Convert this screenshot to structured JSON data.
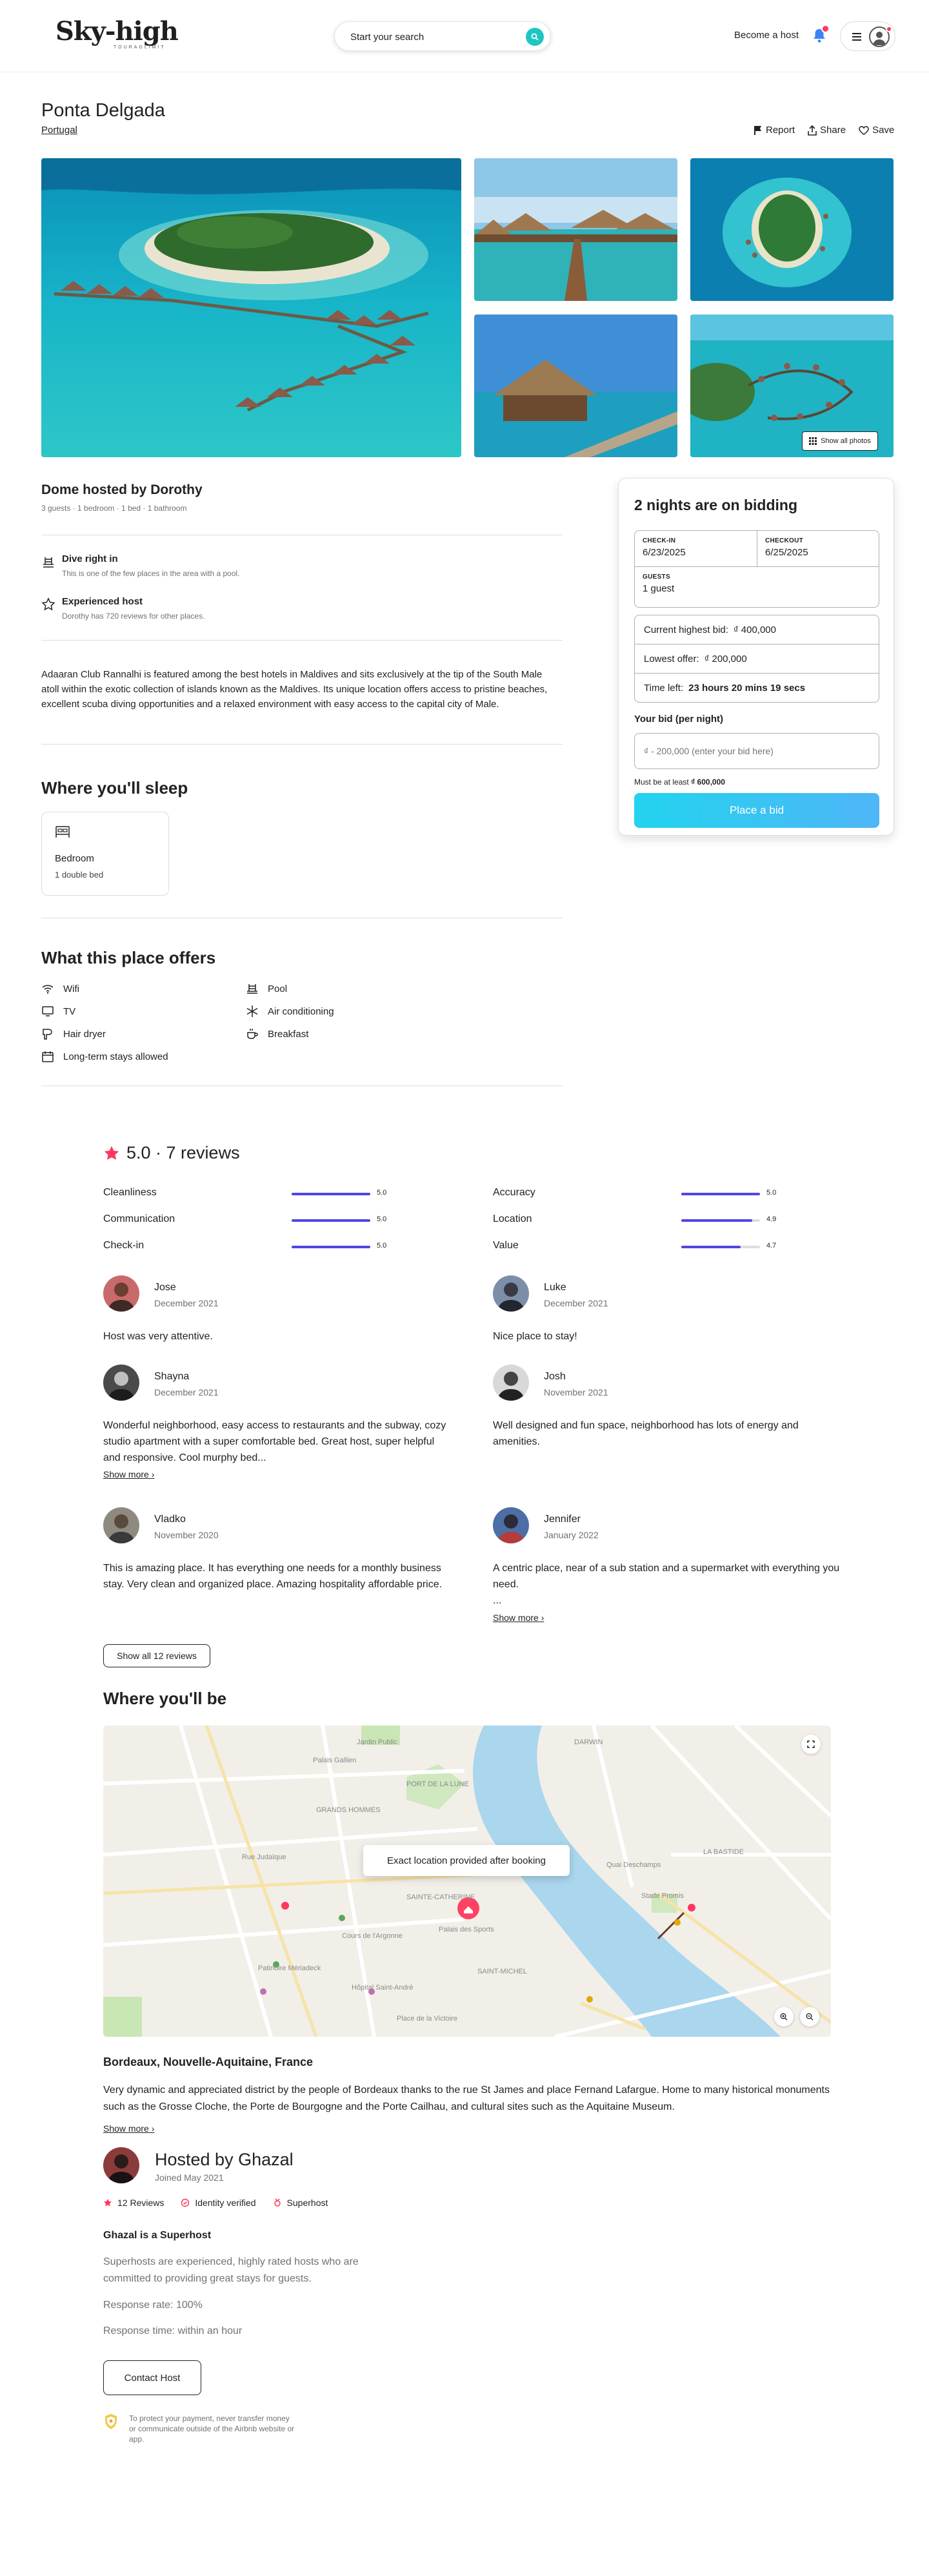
{
  "header": {
    "logo": "Sky-high",
    "logo_tagline": "TOURAGLIMIT",
    "search_placeholder": "Start your search",
    "become_host": "Become a host"
  },
  "listing": {
    "title": "Ponta Delgada",
    "location": "Portugal",
    "actions": [
      "Report",
      "Share",
      "Save"
    ],
    "show_all_photos": "Show all photos",
    "hosted_title": "Dome hosted by Dorothy",
    "hosted_sub": "3 guests · 1 bedroom · 1 bed · 1 bathroom",
    "features": [
      {
        "title": "Dive right in",
        "sub": "This is one of the few places in the area with a pool."
      },
      {
        "title": "Experienced host",
        "sub": "Dorothy has 720 reviews for other places."
      }
    ],
    "description": "Adaaran Club Rannalhi is featured among the best hotels in Maldives and sits exclusively at the tip of the South Male atoll within the exotic collection of islands known as the Maldives. Its unique location offers access to pristine beaches, excellent scuba diving opportunities and a relaxed environment with easy access to the capital city of Male."
  },
  "sleep": {
    "title": "Where you'll sleep",
    "room": "Bedroom",
    "bed": "1 double bed"
  },
  "offers": {
    "title": "What this place offers",
    "items": [
      "Wifi",
      "Pool",
      "TV",
      "Air conditioning",
      "Hair dryer",
      "Breakfast",
      "Long-term stays allowed"
    ]
  },
  "bidding": {
    "title": "2 nights are on bidding",
    "checkin_label": "CHECK-IN",
    "checkin": "6/23/2025",
    "checkout_label": "CHECKOUT",
    "checkout": "6/25/2025",
    "guests_label": "GUESTS",
    "guests": "1 guest",
    "highest_label": "Current highest bid:",
    "highest_value": "₫ 400,000",
    "lowest_label": "Lowest offer:",
    "lowest_value": "₫ 200,000",
    "time_label": "Time left:",
    "time_value": "23 hours 20 mins 19 secs",
    "your_bid_label": "Your bid (per night)",
    "bid_placeholder": "₫ - 200,000 (enter your bid here)",
    "min_prefix": "Must be at least",
    "min_value": "₫ 600,000",
    "button": "Place a bid"
  },
  "reviews": {
    "heading": "5.0 · 7 reviews",
    "ratings": [
      {
        "label": "Cleanliness",
        "score": "5.0",
        "fraction": 1.0
      },
      {
        "label": "Accuracy",
        "score": "5.0",
        "fraction": 1.0
      },
      {
        "label": "Communication",
        "score": "5.0",
        "fraction": 1.0
      },
      {
        "label": "Location",
        "score": "4.9",
        "fraction": 0.9
      },
      {
        "label": "Check-in",
        "score": "5.0",
        "fraction": 1.0
      },
      {
        "label": "Value",
        "score": "4.7",
        "fraction": 0.75
      }
    ],
    "items": [
      {
        "name": "Jose",
        "date": "December 2021",
        "text": "Host was very attentive."
      },
      {
        "name": "Luke",
        "date": "December 2021",
        "text": "Nice place to stay!"
      },
      {
        "name": "Shayna",
        "date": "December 2021",
        "text": "Wonderful neighborhood, easy access to restaurants and the subway, cozy studio apartment with a super comfortable bed. Great host, super helpful and responsive. Cool murphy bed..."
      },
      {
        "name": "Josh",
        "date": "November 2021",
        "text": "Well designed and fun space, neighborhood has lots of energy and amenities."
      },
      {
        "name": "Vladko",
        "date": "November 2020",
        "text": "This is amazing place. It has everything one needs for a monthly business stay. Very clean and organized place. Amazing hospitality affordable price."
      },
      {
        "name": "Jennifer",
        "date": "January 2022",
        "text": "A centric place, near of a sub station and a supermarket with everything you need.\n..."
      }
    ],
    "show_more": "Show more",
    "show_all": "Show all 12 reviews"
  },
  "map": {
    "title": "Where you'll be",
    "tooltip": "Exact location provided after booking",
    "labels": [
      "GRANDS HOMMES",
      "PORT DE LA LUNE",
      "SAINTE-CATHERINE",
      "SAINT-MICHEL",
      "LA BASTIDE",
      "Stade Promis",
      "Palais des Sports",
      "Patinoire Mériadeck",
      "Jardin Public",
      "Rue Judaïque",
      "DARWIN",
      "Palais Gallien",
      "Hôpital Saint-André",
      "Place de la Victoire",
      "Quai Deschamps",
      "Cours de l'Argonne"
    ],
    "place": "Bordeaux, Nouvelle-Aquitaine, France",
    "description": "Very dynamic and appreciated district by the people of Bordeaux thanks to the rue St James and place Fernand Lafargue. Home to many historical monuments such as the Grosse Cloche, the Porte de Bourgogne and the Porte Cailhau, and cultural sites such as the Aquitaine Museum.",
    "show_more": "Show more"
  },
  "host": {
    "name": "Hosted by Ghazal",
    "joined": "Joined May 2021",
    "badges": [
      "12 Reviews",
      "Identity verified",
      "Superhost"
    ],
    "superhost_title": "Ghazal is a Superhost",
    "superhost_desc": "Superhosts are experienced, highly rated hosts who are committed to providing great stays for guests.",
    "response_rate": "Response rate: 100%",
    "response_time": "Response time: within an hour",
    "contact": "Contact Host",
    "protect": "To protect your payment, never transfer money or communicate outside of the Airbnb website or app."
  },
  "colors": {
    "accent": "#1ec6c3",
    "brand_red": "#ff385c",
    "bar": "#4f46e5"
  }
}
